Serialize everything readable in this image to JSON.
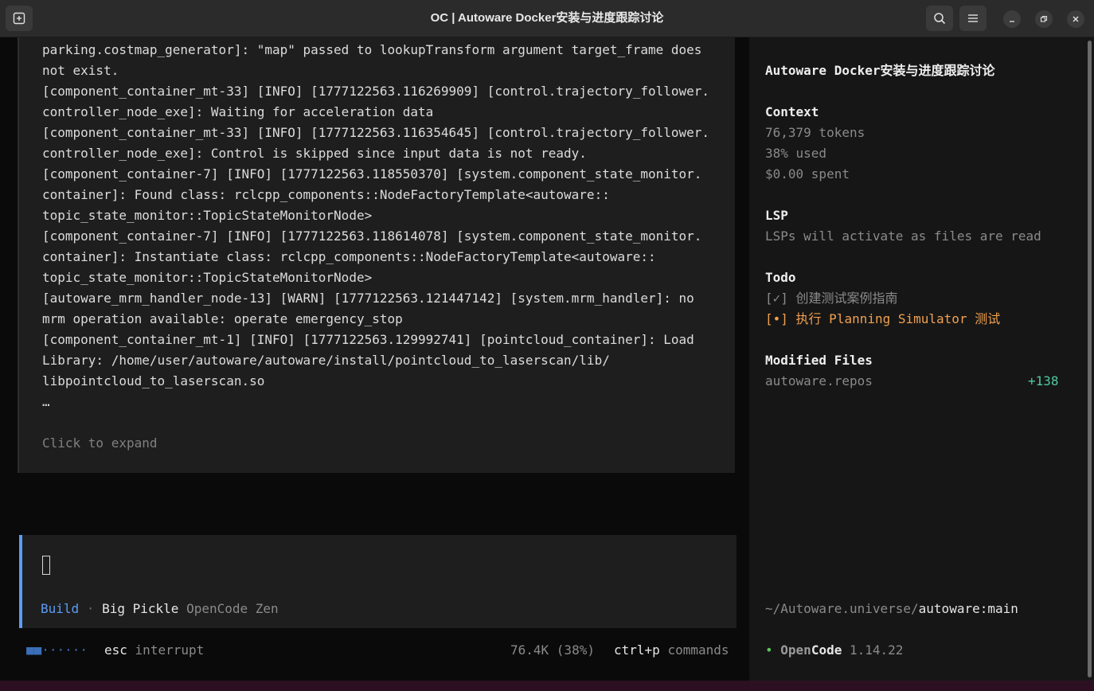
{
  "window": {
    "title": "OC | Autoware Docker安装与进度跟踪讨论",
    "icons": [
      "new-tab-icon",
      "search-icon",
      "menu-icon",
      "minimize-icon",
      "restore-icon",
      "close-icon"
    ]
  },
  "log": {
    "lines": [
      "parking.costmap_generator]: \"map\" passed to lookupTransform argument target_frame does",
      "not exist.",
      "[component_container_mt-33] [INFO] [1777122563.116269909] [control.trajectory_follower.",
      "controller_node_exe]: Waiting for acceleration data",
      "[component_container_mt-33] [INFO] [1777122563.116354645] [control.trajectory_follower.",
      "controller_node_exe]: Control is skipped since input data is not ready.",
      "[component_container-7] [INFO] [1777122563.118550370] [system.component_state_monitor.",
      "container]: Found class: rclcpp_components::NodeFactoryTemplate<autoware::",
      "topic_state_monitor::TopicStateMonitorNode>",
      "[component_container-7] [INFO] [1777122563.118614078] [system.component_state_monitor.",
      "container]: Instantiate class: rclcpp_components::NodeFactoryTemplate<autoware::",
      "topic_state_monitor::TopicStateMonitorNode>",
      "[autoware_mrm_handler_node-13] [WARN] [1777122563.121447142] [system.mrm_handler]: no",
      "mrm operation available: operate emergency_stop",
      "[component_container_mt-1] [INFO] [1777122563.129992741] [pointcloud_container]: Load",
      "Library: /home/user/autoware/autoware/install/pointcloud_to_laserscan/lib/",
      "libpointcloud_to_laserscan.so",
      "…"
    ],
    "expand_label": "Click to expand"
  },
  "input": {
    "mode": "Build",
    "separator": "·",
    "model": "Big Pickle",
    "provider": "OpenCode Zen"
  },
  "status": {
    "spinner": "■■······",
    "esc_key": "esc",
    "esc_action": "interrupt",
    "usage": "76.4K (38%)",
    "cmd_key": "ctrl+p",
    "cmd_action": "commands"
  },
  "sidebar": {
    "session_title": "Autoware Docker安装与进度跟踪讨论",
    "context": {
      "heading": "Context",
      "tokens": "76,379 tokens",
      "used": "38% used",
      "spent": "$0.00 spent"
    },
    "lsp": {
      "heading": "LSP",
      "message": "LSPs will activate as files are read"
    },
    "todo": {
      "heading": "Todo",
      "items": [
        {
          "mark": "[✓]",
          "label": "创建测试案例指南",
          "status": "done"
        },
        {
          "mark": "[•]",
          "label": "执行 Planning Simulator 测试",
          "status": "in_progress"
        }
      ]
    },
    "modified": {
      "heading": "Modified Files",
      "files": [
        {
          "name": "autoware.repos",
          "delta": "+138"
        }
      ]
    },
    "path": {
      "prefix": "~/Autoware.universe/",
      "branch": "autoware:main"
    },
    "app": {
      "bullet": "•",
      "name_a": "Open",
      "name_b": "Code",
      "version": "1.14.22"
    }
  },
  "colors": {
    "accent": "#5c9cf5",
    "in_progress": "#f0a050",
    "added": "#4ec9a0",
    "bullet": "#5ac85a"
  }
}
